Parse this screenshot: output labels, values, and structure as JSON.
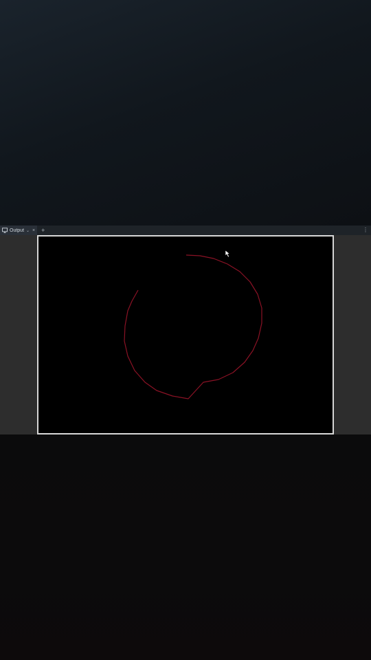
{
  "panel": {
    "tab_label": "Output",
    "tab_icon": "monitor-icon",
    "dropdown_icon": "chevron-down-icon",
    "close_symbol": "×",
    "add_symbol": "+",
    "menu_symbol": "⋮"
  },
  "viewport": {
    "background": "#000000",
    "stroke_color": "#8b1225"
  }
}
